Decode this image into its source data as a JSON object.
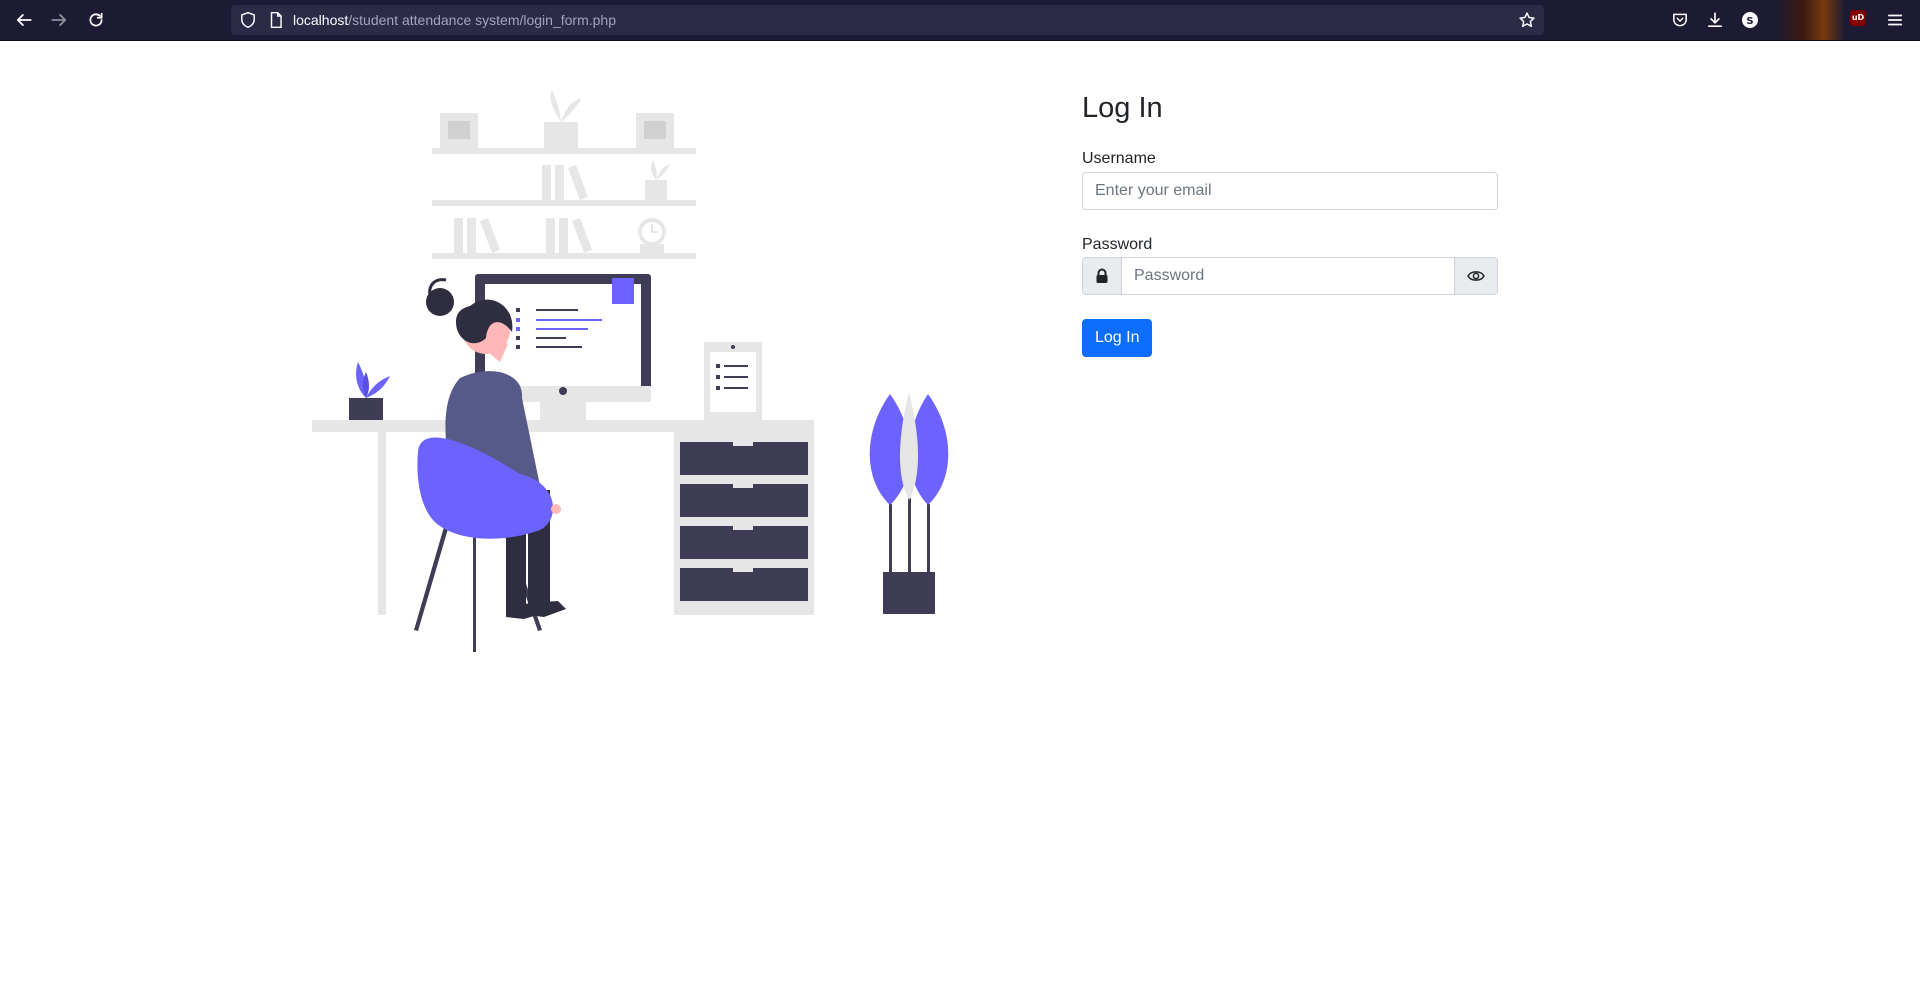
{
  "browser": {
    "url_host": "localhost",
    "url_path": "/student attendance system/login_form.php",
    "icons": {
      "back": "arrow-left-icon",
      "forward": "arrow-right-icon",
      "reload": "reload-icon",
      "tracking_protection": "shield-icon",
      "page_info": "page-icon",
      "bookmark": "star-icon",
      "pocket": "pocket-icon",
      "downloads": "download-icon",
      "extensions": "puzzle-icon",
      "menu": "hamburger-menu-icon"
    },
    "ext_avatar_letter": "S",
    "ublock_badge": "uD"
  },
  "form": {
    "title": "Log In",
    "username_label": "Username",
    "username_placeholder": "Enter your email",
    "password_label": "Password",
    "password_placeholder": "Password",
    "submit_label": "Log In"
  },
  "colors": {
    "primary": "#0d6efd",
    "illustration_accent": "#6c63ff",
    "illustration_dark": "#3f3d56",
    "toolbar_bg": "#1c1b33"
  }
}
